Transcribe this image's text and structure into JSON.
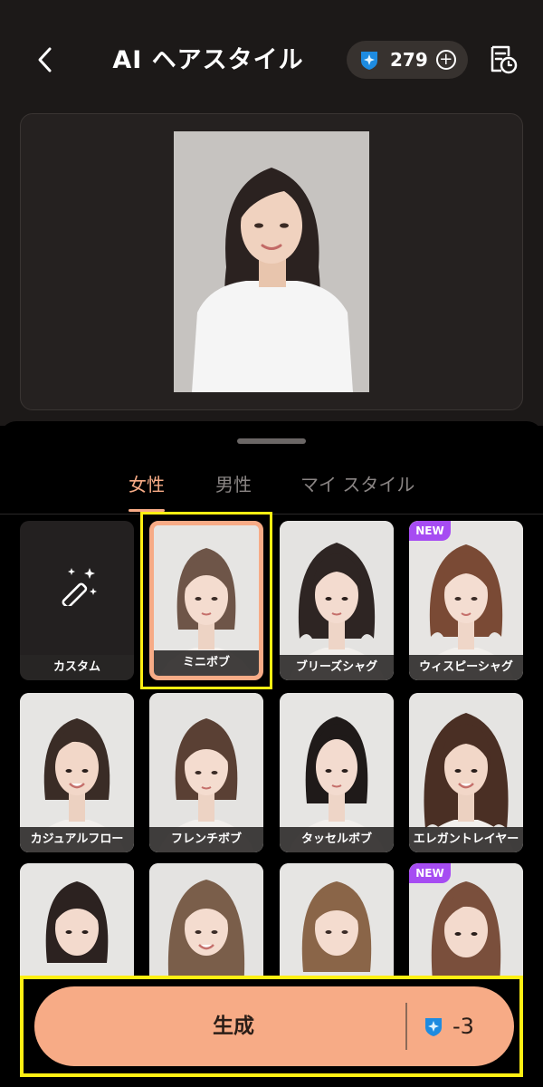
{
  "header": {
    "title": "AI ヘアスタイル",
    "credits": "279",
    "back_icon": "chevron-left-icon",
    "history_icon": "history-icon"
  },
  "tabs": [
    {
      "label": "女性",
      "active": true
    },
    {
      "label": "男性",
      "active": false
    },
    {
      "label": "マイ スタイル",
      "active": false
    }
  ],
  "styles_row1": [
    "カスタム",
    "ミニボブ",
    "ブリーズシャグ",
    "ウィスピーシャグ"
  ],
  "styles_row2": [
    "カジュアルフロー",
    "フレンチボブ",
    "タッセルボブ",
    "エレガントレイヤー"
  ],
  "badges": {
    "new": "NEW"
  },
  "generate": {
    "label": "生成",
    "cost": "-3"
  },
  "colors": {
    "accent": "#f7ab86",
    "new_badge": "#a64cf2",
    "highlight": "#ffef13",
    "gem": "#1e8be0"
  }
}
